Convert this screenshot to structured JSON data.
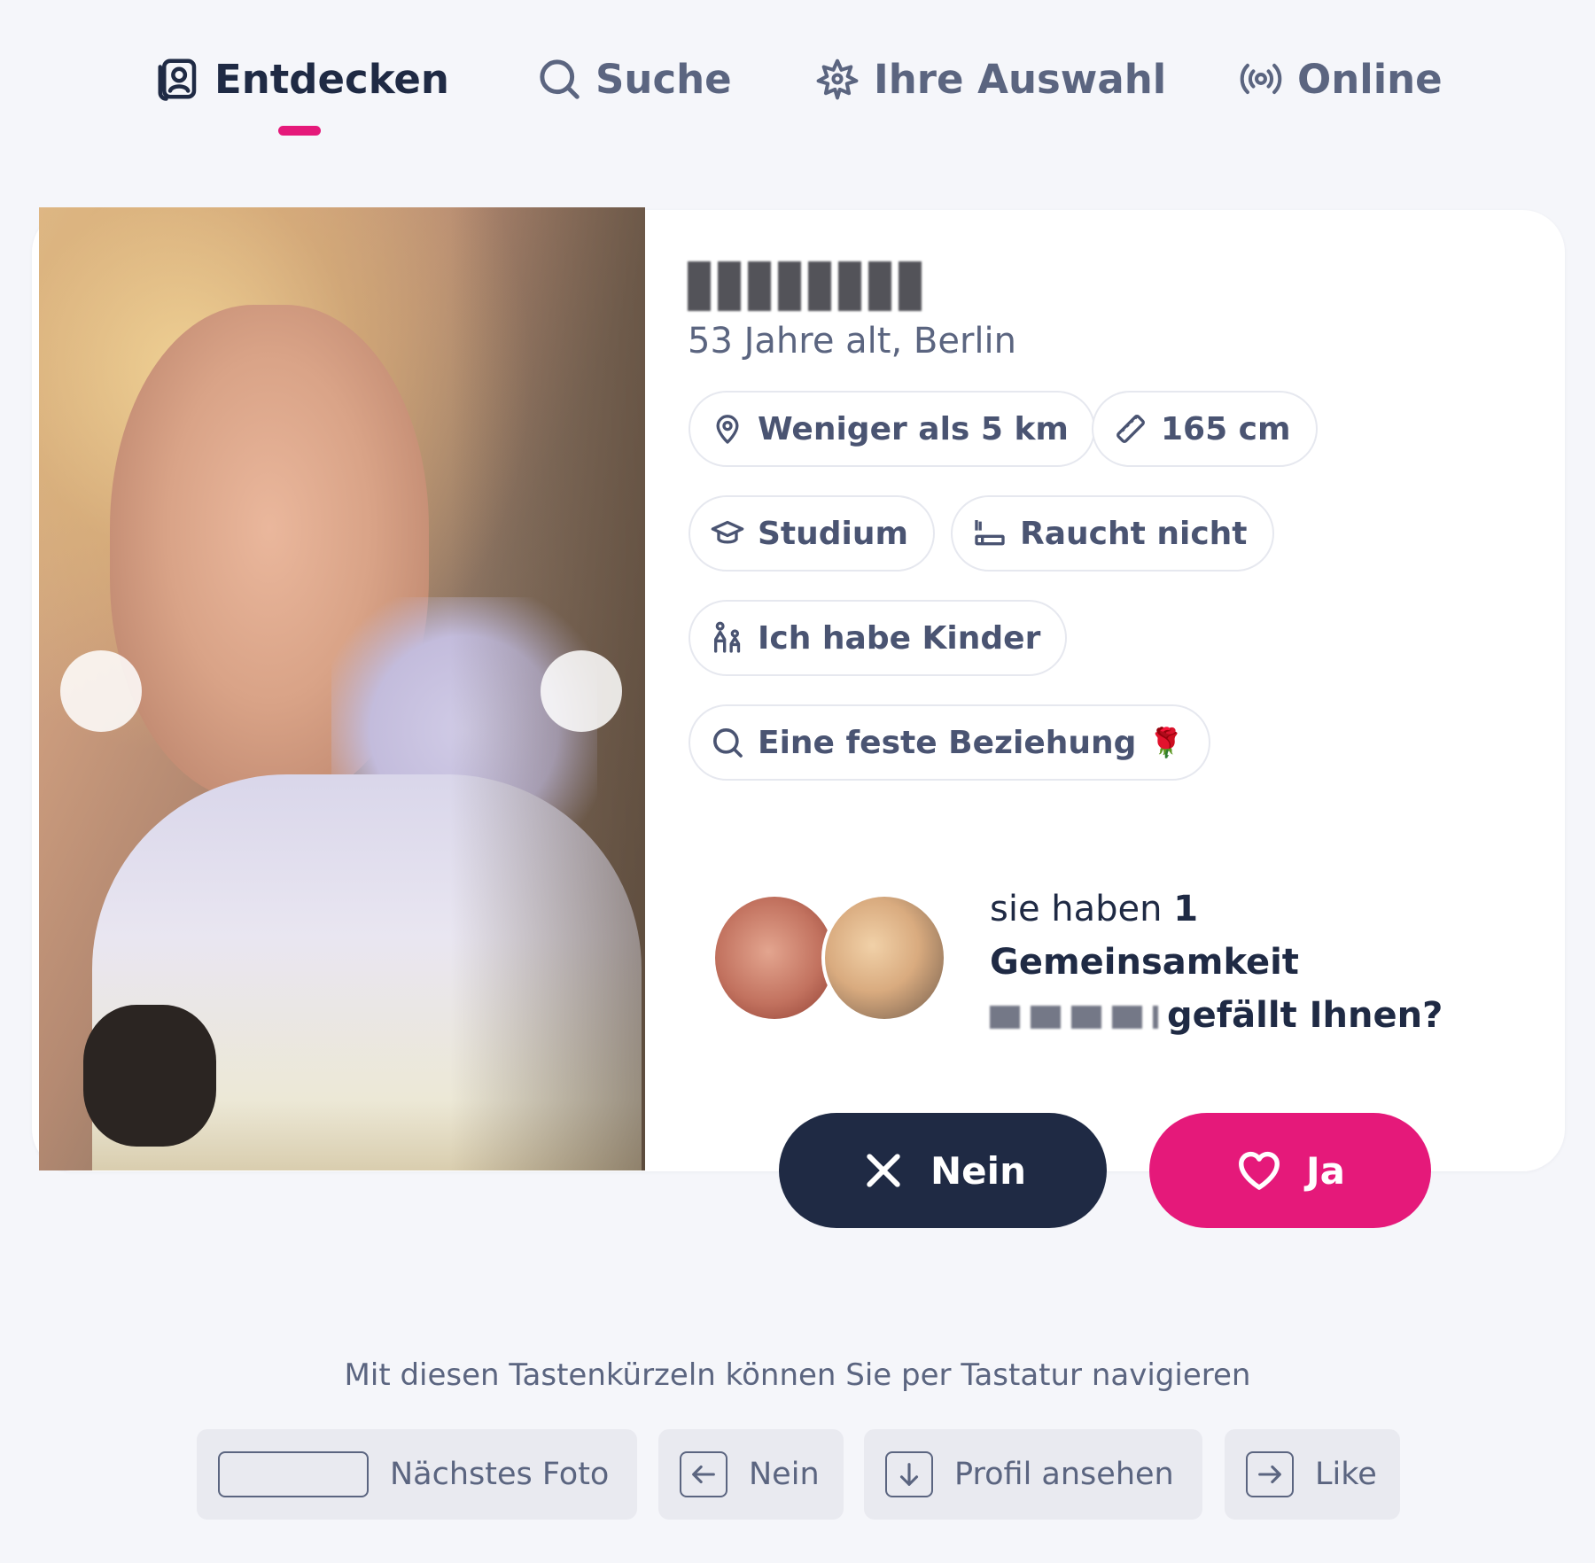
{
  "nav": {
    "tabs": [
      {
        "label": "Entdecken",
        "icon": "discover-icon",
        "active": true
      },
      {
        "label": "Suche",
        "icon": "search-icon",
        "active": false
      },
      {
        "label": "Ihre Auswahl",
        "icon": "sparkle-icon",
        "active": false
      },
      {
        "label": "Online",
        "icon": "broadcast-icon",
        "active": false
      }
    ],
    "accent_color": "#e5197a"
  },
  "profile": {
    "subtitle": "53 Jahre alt, Berlin",
    "chips": {
      "distance": "Weniger als 5 km",
      "height": "165 cm",
      "education": "Studium",
      "smoking": "Raucht nicht",
      "children": "Ich habe Kinder",
      "relationship": "Eine feste Beziehung",
      "relationship_emoji": "🌹"
    }
  },
  "commonality": {
    "prefix": "sie haben",
    "count": "1",
    "label": "Gemeinsamkeit",
    "question": "gefällt Ihnen?"
  },
  "actions": {
    "no_label": "Nein",
    "yes_label": "Ja",
    "no_color": "#1f2a44",
    "yes_color": "#e5197a"
  },
  "shortcuts": {
    "hint": "Mit diesen Tastenkürzeln können Sie per Tastatur navigieren",
    "items": [
      {
        "key_icon": "spacebar-key",
        "label": "Nächstes Foto"
      },
      {
        "key_icon": "arrow-left-key",
        "label": "Nein"
      },
      {
        "key_icon": "arrow-down-key",
        "label": "Profil ansehen"
      },
      {
        "key_icon": "arrow-right-key",
        "label": "Like"
      }
    ]
  }
}
